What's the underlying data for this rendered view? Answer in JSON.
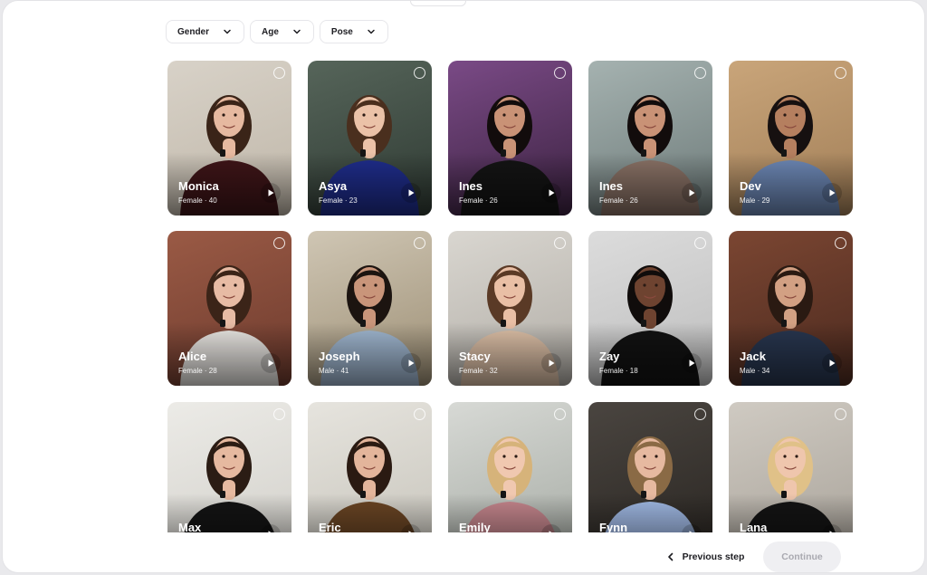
{
  "filters": [
    {
      "label": "Gender",
      "icon": "chevron-down-icon"
    },
    {
      "label": "Age",
      "icon": "chevron-down-icon"
    },
    {
      "label": "Pose",
      "icon": "chevron-down-icon"
    }
  ],
  "avatars": [
    {
      "name": "Monica",
      "meta": "Female · 40",
      "bg": "#d8d2c8",
      "bg2": "#bfb6a8",
      "skin": "#e6b9a0",
      "hair": "#3a2418",
      "top": "#3f1518"
    },
    {
      "name": "Asya",
      "meta": "Female · 23",
      "bg": "#56655a",
      "bg2": "#2f3a33",
      "skin": "#ebc2a8",
      "hair": "#4a2f1e",
      "top": "#1f2d8c"
    },
    {
      "name": "Ines",
      "meta": "Female · 26",
      "bg": "#7a4a86",
      "bg2": "#3b2240",
      "skin": "#c99276",
      "hair": "#120c0c",
      "top": "#141414"
    },
    {
      "name": "Ines",
      "meta": "Female · 26",
      "bg": "#a5b2b0",
      "bg2": "#6d7a79",
      "skin": "#c99276",
      "hair": "#120c0c",
      "top": "#8a7266"
    },
    {
      "name": "Dev",
      "meta": "Male · 29",
      "bg": "#c9a57a",
      "bg2": "#a17e57",
      "skin": "#b57f5f",
      "hair": "#161010",
      "top": "#6d88b6"
    },
    {
      "name": "Alice",
      "meta": "Female · 28",
      "bg": "#9a5a45",
      "bg2": "#6e3b2e",
      "skin": "#e7bba4",
      "hair": "#3b2418",
      "top": "#e9e6e2"
    },
    {
      "name": "Joseph",
      "meta": "Male · 41",
      "bg": "#cfc6b4",
      "bg2": "#9d8f75",
      "skin": "#c9957a",
      "hair": "#1c1410",
      "top": "#9fb6cf"
    },
    {
      "name": "Stacy",
      "meta": "Female · 32",
      "bg": "#d9d6d0",
      "bg2": "#b1ada6",
      "skin": "#e9bfa5",
      "hair": "#5a3a26",
      "top": "#dcbfa6"
    },
    {
      "name": "Zay",
      "meta": "Female · 18",
      "bg": "#dcdcdc",
      "bg2": "#bdbdbd",
      "skin": "#6e4330",
      "hair": "#100c0b",
      "top": "#121212"
    },
    {
      "name": "Jack",
      "meta": "Male · 34",
      "bg": "#7b4632",
      "bg2": "#4c2a1f",
      "skin": "#d2a083",
      "hair": "#2a1a12",
      "top": "#28364f"
    },
    {
      "name": "Max",
      "meta": "",
      "bg": "#ecebe7",
      "bg2": "#d2d0ca",
      "skin": "#e6b9a0",
      "hair": "#2b1c14",
      "top": "#141414"
    },
    {
      "name": "Eric",
      "meta": "",
      "bg": "#e6e4de",
      "bg2": "#c7c4bb",
      "skin": "#e3b59b",
      "hair": "#2a1a12",
      "top": "#6a4524"
    },
    {
      "name": "Emily",
      "meta": "",
      "bg": "#d7d9d5",
      "bg2": "#a7aca5",
      "skin": "#f0c8b0",
      "hair": "#d6b37a",
      "top": "#c5868d"
    },
    {
      "name": "Fynn",
      "meta": "",
      "bg": "#4a4540",
      "bg2": "#2a2622",
      "skin": "#e6b9a0",
      "hair": "#8a6a45",
      "top": "#9fb8e3"
    },
    {
      "name": "Lana",
      "meta": "",
      "bg": "#cfcac2",
      "bg2": "#a9a39a",
      "skin": "#efc6ad",
      "hair": "#e0c188",
      "top": "#141414"
    }
  ],
  "footer": {
    "previous_label": "Previous step",
    "continue_label": "Continue"
  }
}
